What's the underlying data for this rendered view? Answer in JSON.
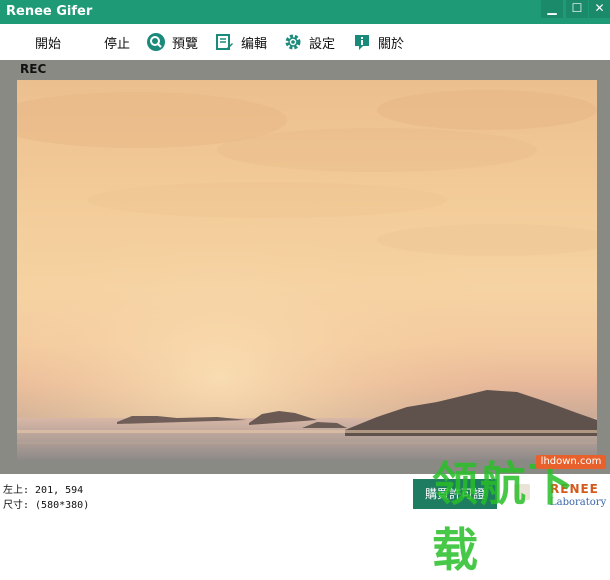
{
  "window": {
    "title": "Renee Gifer",
    "min_glyph": "▁",
    "max_glyph": "☐",
    "close_glyph": "✕"
  },
  "toolbar": {
    "items": [
      {
        "label": "開始",
        "icon": "play-icon"
      },
      {
        "label": "停止",
        "icon": "stop-icon"
      },
      {
        "label": "預覽",
        "icon": "preview-search-icon"
      },
      {
        "label": "编輯",
        "icon": "edit-icon"
      },
      {
        "label": "設定",
        "icon": "gear-icon"
      },
      {
        "label": "關於",
        "icon": "info-icon"
      }
    ]
  },
  "recording": {
    "label": "REC"
  },
  "status": {
    "position": "左上: 201, 594",
    "size": "尺寸: (580*380)"
  },
  "buy_button": {
    "label": "購買許可證"
  },
  "brand": {
    "line1": "RENEE",
    "line2": "Laboratory"
  },
  "watermark": {
    "cn": "领航下载",
    "site": "lhdown.com"
  },
  "colors": {
    "titlebar": "#1e9a76",
    "toolbar_icon": "#1a8a7a",
    "buy_button": "#1e7c61"
  }
}
